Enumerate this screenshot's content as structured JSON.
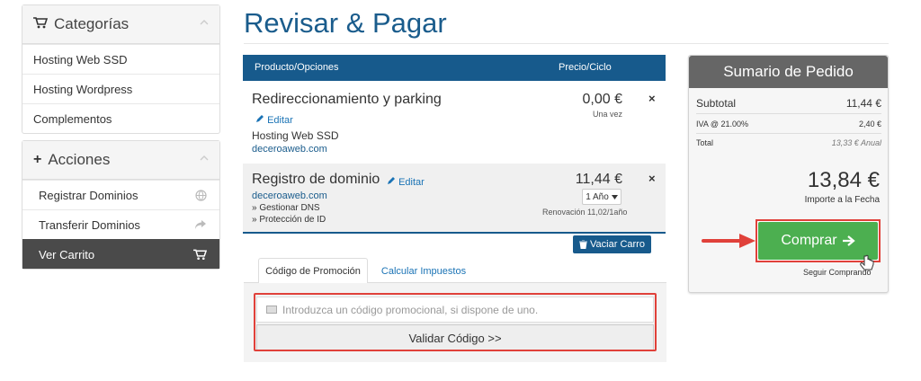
{
  "sidebar": {
    "categories": {
      "title": "Categorías",
      "items": [
        "Hosting Web SSD",
        "Hosting Wordpress",
        "Complementos"
      ]
    },
    "actions": {
      "title": "Acciones",
      "items": [
        {
          "label": "Registrar Dominios",
          "icon": "globe-icon"
        },
        {
          "label": "Transferir Dominios",
          "icon": "share-arrow-icon"
        },
        {
          "label": "Ver Carrito",
          "icon": "cart-icon",
          "active": true
        }
      ]
    }
  },
  "page": {
    "title": "Revisar & Pagar"
  },
  "cart": {
    "headers": {
      "product": "Producto/Opciones",
      "price": "Precio/Ciclo"
    },
    "items": [
      {
        "name": "Redireccionamiento y parking",
        "edit": "Editar",
        "plan": "Hosting Web SSD",
        "domain": "deceroaweb.com",
        "price": "0,00 €",
        "cycle": "Una vez"
      },
      {
        "name": "Registro de dominio",
        "edit": "Editar",
        "domain": "deceroaweb.com",
        "options": [
          "» Gestionar DNS",
          "» Protección de ID"
        ],
        "price": "11,44 €",
        "term": "1 Año",
        "renewal": "Renovación 11,02/1año"
      }
    ],
    "empty_cart": "Vaciar Carro"
  },
  "promo": {
    "tabs": [
      "Código de Promoción",
      "Calcular Impuestos"
    ],
    "placeholder": "Introduzca un código promocional, si dispone de uno.",
    "validate": "Validar Código >>"
  },
  "summary": {
    "title": "Sumario de Pedido",
    "subtotal_label": "Subtotal",
    "subtotal": "11,44 €",
    "tax_label": "IVA @ 21.00%",
    "tax": "2,40 €",
    "total_label": "Total",
    "total_annual": "13,33 € Anual",
    "grand_total": "13,84 €",
    "grand_label": "Importe a la Fecha",
    "checkout": "Comprar",
    "continue": "Seguir Comprando"
  },
  "colors": {
    "primary": "#175a8c",
    "title": "#1a5c8c",
    "buy": "#4caf50",
    "highlight": "#e0413a"
  }
}
